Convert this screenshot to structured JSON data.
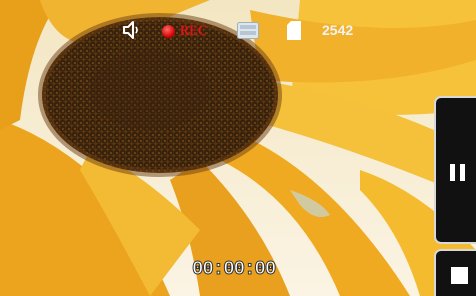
{
  "status_bar": {
    "icons": [
      "speaker-icon",
      "rec-dot-icon",
      "resolution-icon",
      "sd-card-icon"
    ],
    "rec_label": "REC",
    "remaining_count": "2542",
    "rec_color": "#e01414"
  },
  "controls": {
    "pause_icon": "pause-icon",
    "stop_icon": "stop-icon"
  },
  "timer": {
    "elapsed": "00:00:00"
  },
  "scene": {
    "subject": "sunflower",
    "petal_color": "#f4b21c",
    "center_color": "#3a230f"
  }
}
